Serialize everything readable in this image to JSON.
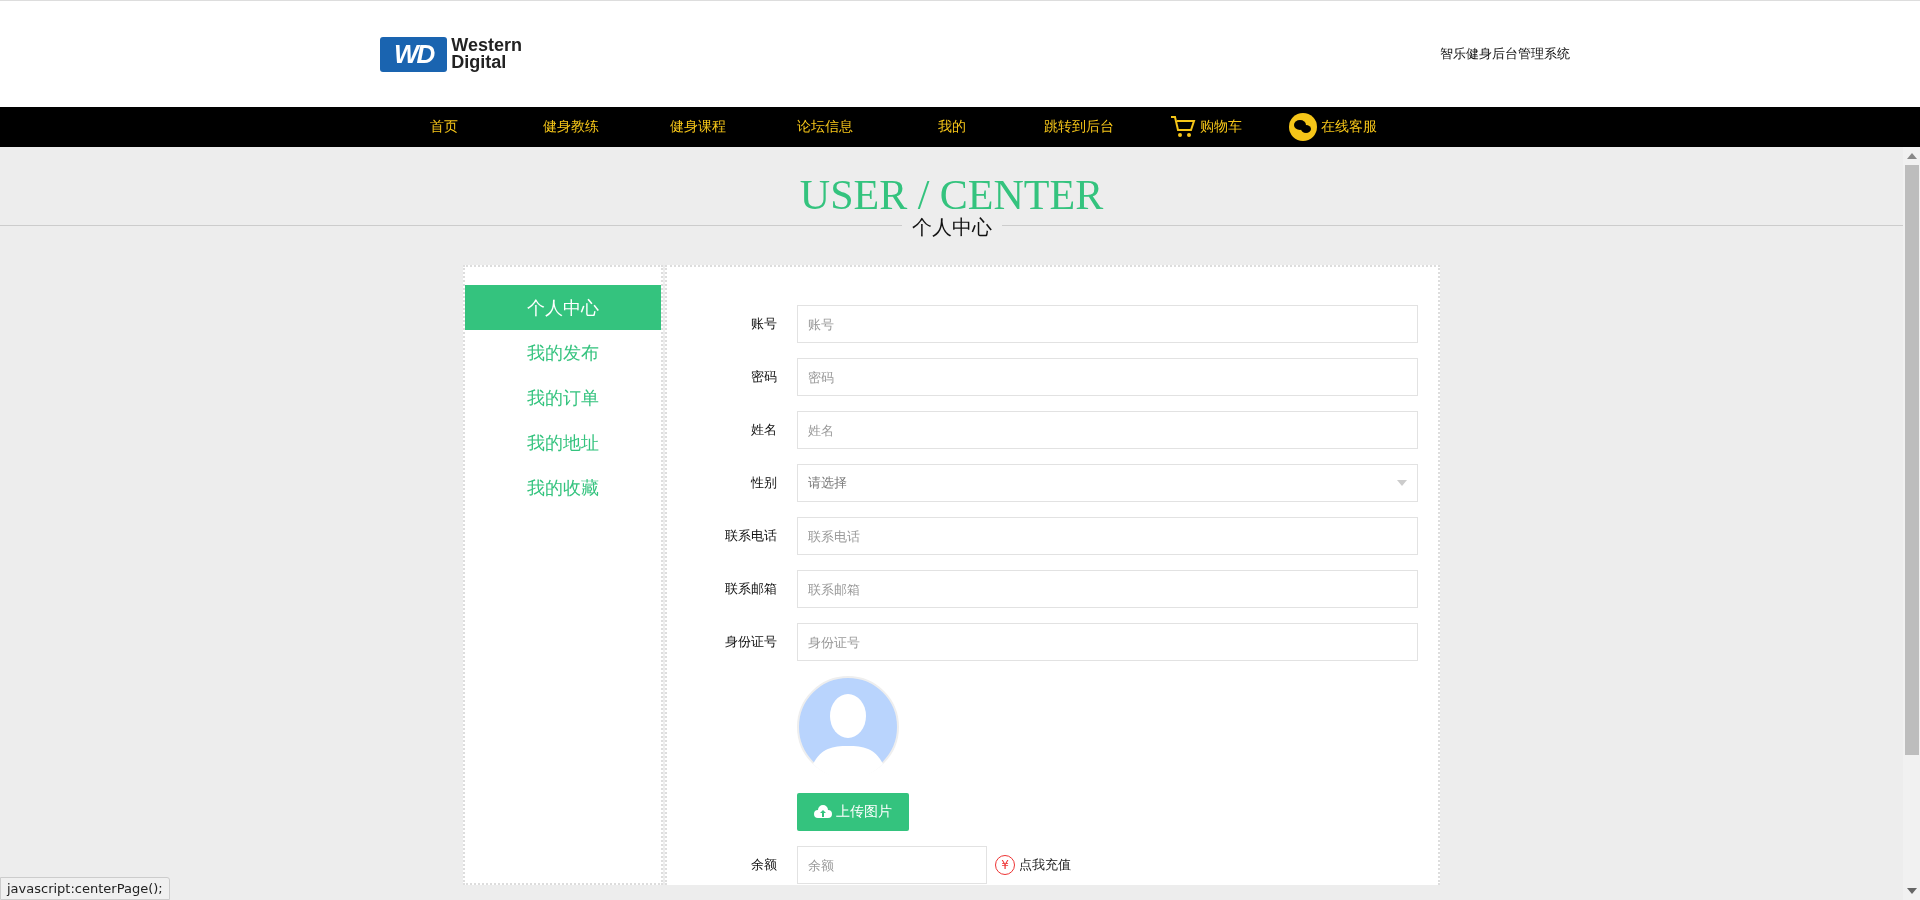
{
  "header": {
    "logo_text": [
      "Western",
      "Digital"
    ],
    "logo_mark": "WD",
    "system_name": "智乐健身后台管理系统"
  },
  "nav": [
    {
      "label": "首页",
      "kind": "text"
    },
    {
      "label": "健身教练",
      "kind": "text"
    },
    {
      "label": "健身课程",
      "kind": "text"
    },
    {
      "label": "论坛信息",
      "kind": "text"
    },
    {
      "label": "我的",
      "kind": "text"
    },
    {
      "label": "跳转到后台",
      "kind": "text"
    },
    {
      "label": "购物车",
      "kind": "cart"
    },
    {
      "label": "在线客服",
      "kind": "chat"
    }
  ],
  "page_title": {
    "english": "USER / CENTER",
    "chinese": "个人中心"
  },
  "sidebar": {
    "items": [
      {
        "label": "个人中心",
        "selected": true
      },
      {
        "label": "我的发布",
        "selected": false
      },
      {
        "label": "我的订单",
        "selected": false
      },
      {
        "label": "我的地址",
        "selected": false
      },
      {
        "label": "我的收藏",
        "selected": false
      }
    ]
  },
  "form": {
    "fields": [
      {
        "label": "账号",
        "placeholder": "账号",
        "kind": "input"
      },
      {
        "label": "密码",
        "placeholder": "密码",
        "kind": "input"
      },
      {
        "label": "姓名",
        "placeholder": "姓名",
        "kind": "input"
      },
      {
        "label": "性别",
        "placeholder": "请选择",
        "kind": "select"
      },
      {
        "label": "联系电话",
        "placeholder": "联系电话",
        "kind": "input"
      },
      {
        "label": "联系邮箱",
        "placeholder": "联系邮箱",
        "kind": "input"
      },
      {
        "label": "身份证号",
        "placeholder": "身份证号",
        "kind": "input"
      }
    ],
    "upload_button": "上传图片",
    "balance": {
      "label": "余额",
      "placeholder": "余额",
      "recharge_icon": "¥",
      "recharge_link": "点我充值"
    }
  },
  "status_bar": "javascript:centerPage();"
}
